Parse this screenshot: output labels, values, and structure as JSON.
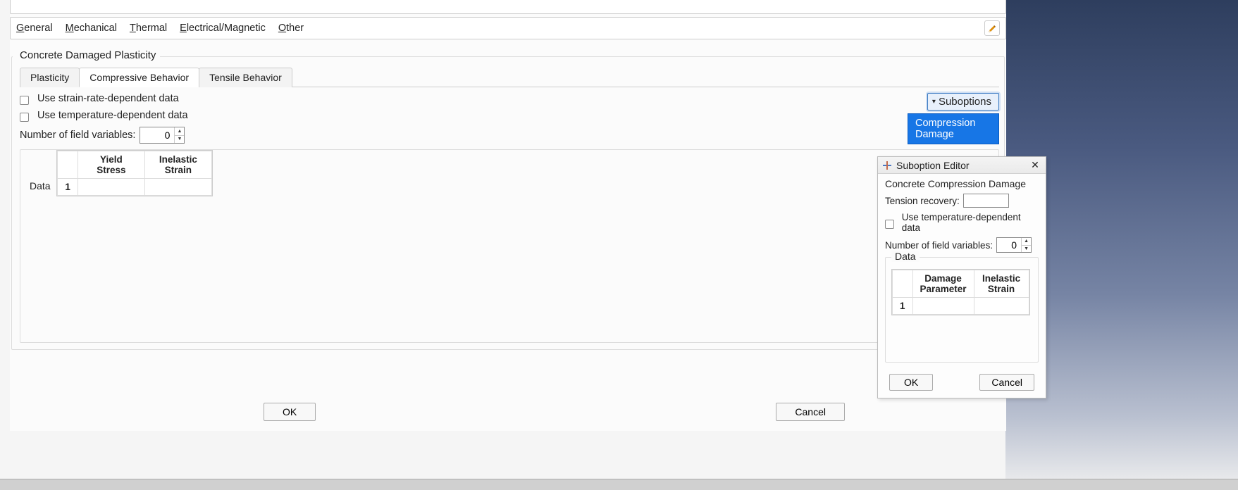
{
  "menubar": {
    "general": "General",
    "mechanical": "Mechanical",
    "thermal": "Thermal",
    "electrical": "Electrical/Magnetic",
    "other": "Other"
  },
  "behavior": {
    "group_title": "Concrete Damaged Plasticity",
    "tabs": {
      "plasticity": "Plasticity",
      "compressive": "Compressive Behavior",
      "tensile": "Tensile Behavior"
    },
    "strain_rate_label": "Use strain-rate-dependent data",
    "temp_label": "Use temperature-dependent data",
    "field_vars_label": "Number of field variables:",
    "field_vars_value": "0",
    "suboptions_label": "Suboptions",
    "suboptions_item": "Compression Damage",
    "data_title": "Data",
    "table": {
      "col1_l1": "Yield",
      "col1_l2": "Stress",
      "col2_l1": "Inelastic",
      "col2_l2": "Strain",
      "row1_num": "1",
      "row1_c1": "",
      "row1_c2": ""
    }
  },
  "main_buttons": {
    "ok": "OK",
    "cancel": "Cancel"
  },
  "popup": {
    "title": "Suboption Editor",
    "sub_title": "Concrete Compression Damage",
    "tension_recovery_label": "Tension recovery:",
    "tension_recovery_value": "",
    "temp_label": "Use temperature-dependent data",
    "field_vars_label": "Number of field variables:",
    "field_vars_value": "0",
    "data_title": "Data",
    "table": {
      "col1_l1": "Damage",
      "col1_l2": "Parameter",
      "col2_l1": "Inelastic",
      "col2_l2": "Strain",
      "row1_num": "1",
      "row1_c1": "",
      "row1_c2": ""
    },
    "buttons": {
      "ok": "OK",
      "cancel": "Cancel"
    }
  }
}
